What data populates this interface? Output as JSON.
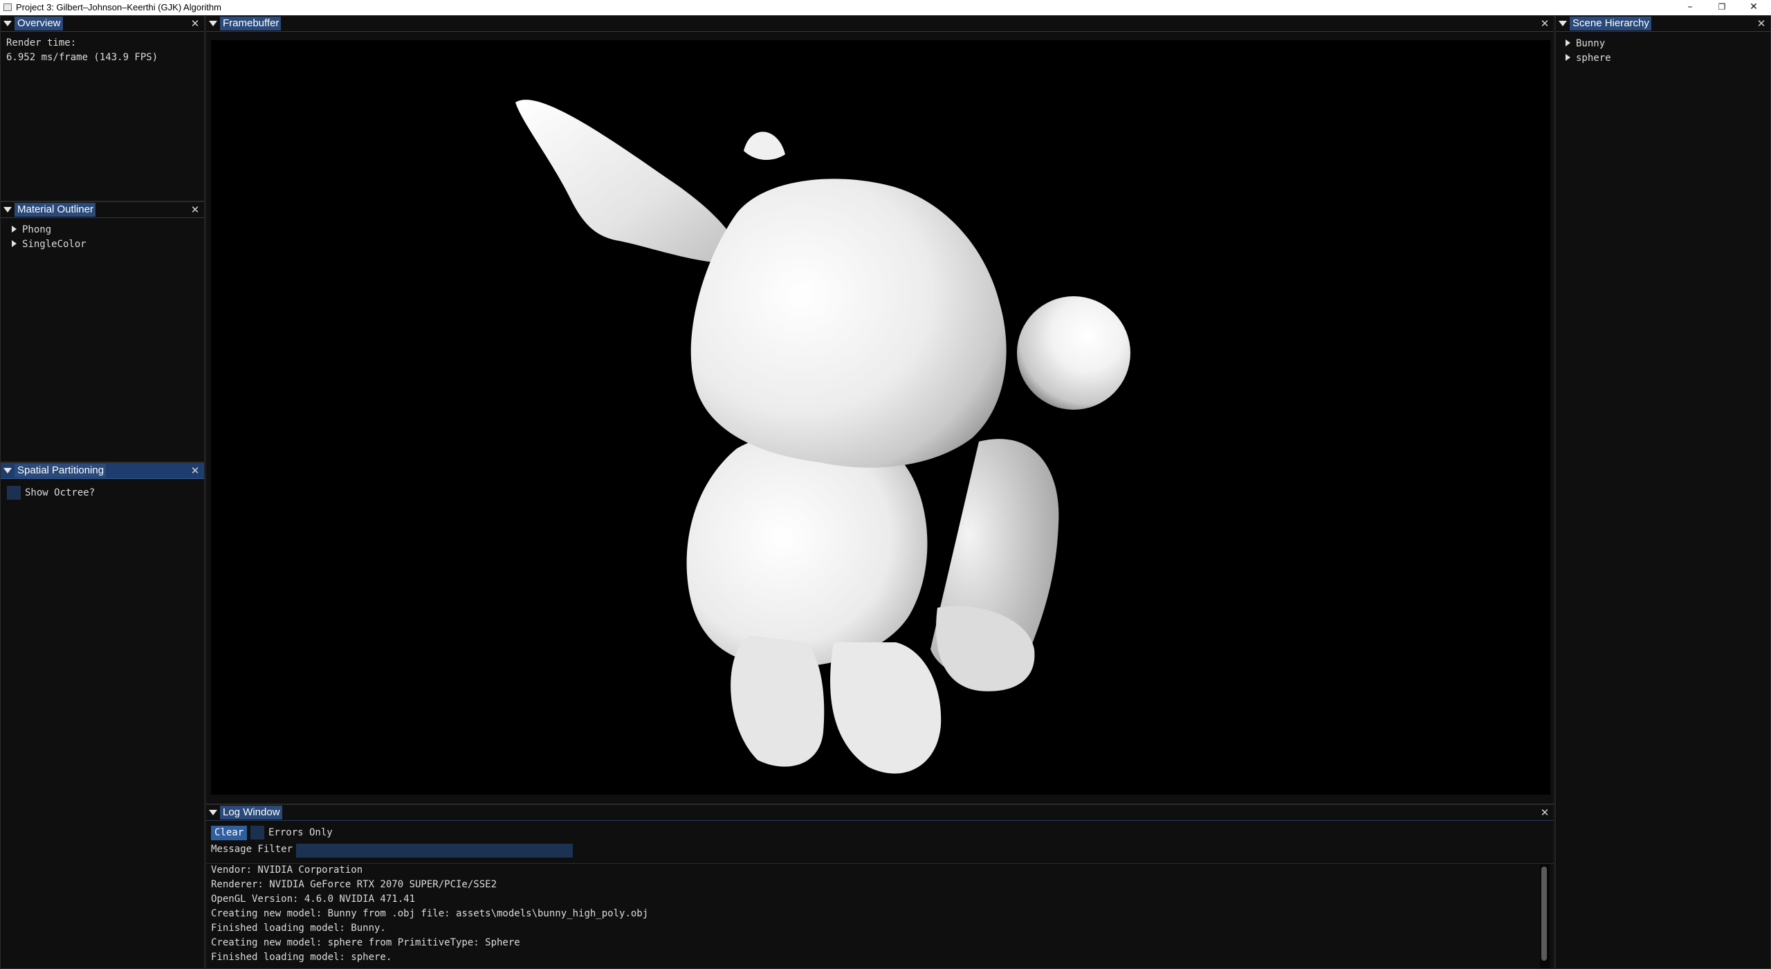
{
  "window": {
    "title": "Project 3: Gilbert–Johnson–Keerthi (GJK) Algorithm",
    "minimize_glyph": "–",
    "restore_glyph": "❐",
    "close_glyph": "✕"
  },
  "overview": {
    "tab": "Overview",
    "render_time_label": "Render time:",
    "render_time_value": "6.952 ms/frame (143.9 FPS)"
  },
  "material_outliner": {
    "tab": "Material Outliner",
    "items": [
      "Phong",
      "SingleColor"
    ]
  },
  "spatial_partitioning": {
    "tab": "Spatial Partitioning",
    "show_octree_label": "Show Octree?",
    "show_octree_checked": false
  },
  "framebuffer": {
    "tab": "Framebuffer",
    "scene": "bunny-and-sphere-render"
  },
  "scene_hierarchy": {
    "tab": "Scene Hierarchy",
    "items": [
      "Bunny",
      "sphere"
    ]
  },
  "log_window": {
    "tab": "Log Window",
    "clear_label": "Clear",
    "errors_only_label": "Errors Only",
    "errors_only_checked": false,
    "message_filter_label": "Message Filter",
    "message_filter_value": "",
    "lines": [
      "Vendor: NVIDIA Corporation",
      "Renderer: NVIDIA GeForce RTX 2070 SUPER/PCIe/SSE2",
      "OpenGL Version: 4.6.0 NVIDIA 471.41",
      "Creating new model: Bunny from .obj file: assets\\models\\bunny_high_poly.obj",
      "Finished loading model: Bunny.",
      "Creating new model: sphere from PrimitiveType: Sphere",
      "Finished loading model: sphere."
    ]
  },
  "colors": {
    "background": "#0f0f0f",
    "title_tab": "#294a7a",
    "active_header": "#1e3c6e",
    "checkbox": "#1c3151",
    "button": "#2f5f9e",
    "text": "#dcdcdc"
  },
  "icons": {
    "collapse": "collapse-triangle-icon",
    "close": "close-icon",
    "tree": "tree-expand-arrow-icon"
  }
}
